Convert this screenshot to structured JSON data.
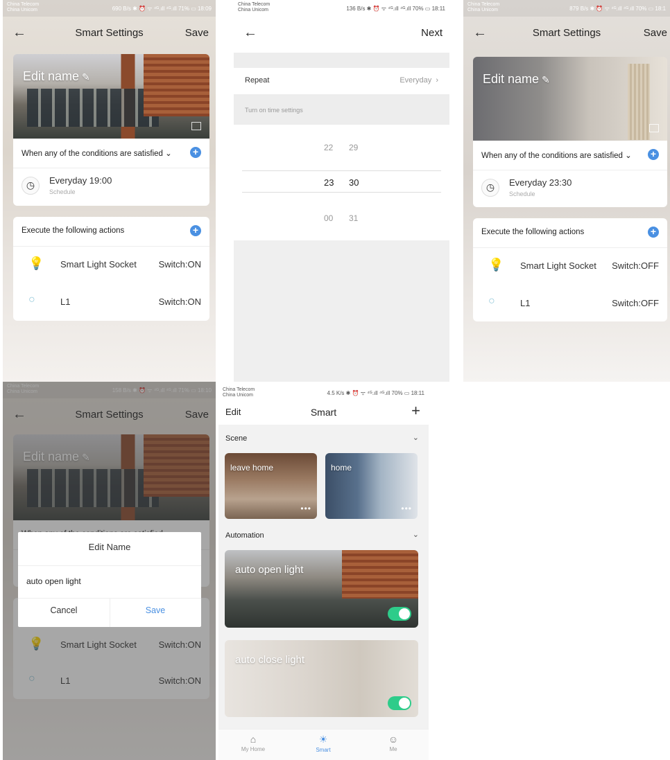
{
  "colors": {
    "accent": "#4a90e2",
    "toggle_on": "#2ecc8a"
  },
  "screen1": {
    "status": {
      "carrier1": "China Telecom",
      "carrier2": "China Unicom",
      "right": "690 B/s ✱ ⏰ ᯤ ⁴ᴳ.ıll ⁴ᴳ.ıll 71% ▭ 18:09"
    },
    "nav": {
      "back": "←",
      "title": "Smart Settings",
      "action": "Save"
    },
    "hero": {
      "edit_label": "Edit name",
      "edit_icon": "pencil-icon"
    },
    "conditions": {
      "header": "When any of the conditions are satisfied",
      "chevron": "⌄",
      "add": "+",
      "time": "Everyday 19:00",
      "type": "Schedule"
    },
    "actions": {
      "header": "Execute the following actions",
      "add": "+",
      "items": [
        {
          "device": "Smart Light Socket",
          "action": "Switch:ON"
        },
        {
          "device": "L1",
          "action": "Switch:ON"
        }
      ]
    }
  },
  "screen2": {
    "status": {
      "carrier1": "China Telecom",
      "carrier2": "China Unicom",
      "right": "136 B/s ✱ ⏰ ᯤ ⁴ᴳ.ıll ⁴ᴳ.ıll 70% ▭ 18:11"
    },
    "nav": {
      "back": "←",
      "action": "Next"
    },
    "repeat": {
      "label": "Repeat",
      "value": "Everyday",
      "chevron": "›"
    },
    "section": "Turn on time settings",
    "picker": {
      "hours": [
        "22",
        "23",
        "00"
      ],
      "minutes": [
        "29",
        "30",
        "31"
      ]
    }
  },
  "screen3": {
    "status": {
      "carrier1": "China Telecom",
      "carrier2": "China Unicom",
      "right": "879 B/s ✱ ⏰ ᯤ ⁴ᴳ.ıll ⁴ᴳ.ıll 70% ▭ 18:1"
    },
    "nav": {
      "back": "←",
      "title": "Smart Settings",
      "action": "Save"
    },
    "hero": {
      "edit_label": "Edit name"
    },
    "conditions": {
      "header": "When any of the conditions are satisfied",
      "chevron": "⌄",
      "add": "+",
      "time": "Everyday 23:30",
      "type": "Schedule"
    },
    "actions": {
      "header": "Execute the following actions",
      "add": "+",
      "items": [
        {
          "device": "Smart Light Socket",
          "action": "Switch:OFF"
        },
        {
          "device": "L1",
          "action": "Switch:OFF"
        }
      ]
    }
  },
  "screen4": {
    "status": {
      "carrier1": "China Telecom",
      "carrier2": "China Unicom",
      "right": "158 B/s ✱ ⏰ ᯤ ⁴ᴳ.ıll ⁴ᴳ.ıll 71% ▭ 18:10"
    },
    "nav": {
      "back": "←",
      "title": "Smart Settings",
      "action": "Save"
    },
    "hero": {
      "edit_label": "Edit name"
    },
    "conditions_header": "When any of the conditions are satisfied",
    "dialog": {
      "title": "Edit Name",
      "value": "auto open light",
      "cancel": "Cancel",
      "save": "Save"
    },
    "actions": [
      {
        "device": "Smart Light Socket",
        "action": "Switch:ON"
      },
      {
        "device": "L1",
        "action": "Switch:ON"
      }
    ]
  },
  "screen5": {
    "status": {
      "carrier1": "China Telecom",
      "carrier2": "China Unicom",
      "right": "4.5 K/s ✱ ⏰ ᯤ ⁴ᴳ.ıll ⁴ᴳ.ıll 70% ▭ 18:11"
    },
    "bar": {
      "left": "Edit",
      "title": "Smart",
      "add": "+"
    },
    "scene_header": "Scene",
    "scenes": [
      {
        "name": "leave home"
      },
      {
        "name": "home"
      }
    ],
    "more": "•••",
    "automation_header": "Automation",
    "automations": [
      {
        "name": "auto open light",
        "enabled": true
      },
      {
        "name": "auto close light",
        "enabled": true
      }
    ],
    "tabs": [
      {
        "label": "My Home",
        "icon": "⌂"
      },
      {
        "label": "Smart",
        "icon": "☀"
      },
      {
        "label": "Me",
        "icon": "☺"
      }
    ]
  }
}
